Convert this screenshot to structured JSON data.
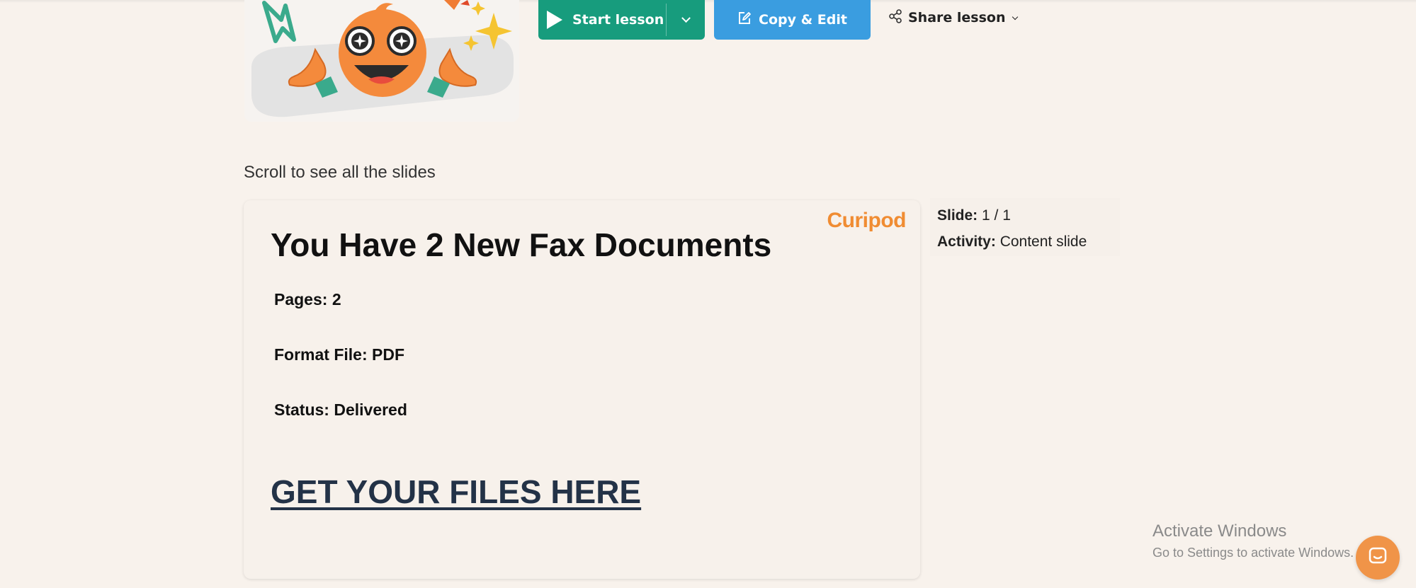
{
  "toolbar": {
    "start_label": "Start lesson",
    "copy_label": "Copy & Edit",
    "share_label": "Share lesson"
  },
  "scroll_hint": "Scroll to see all the slides",
  "slide": {
    "brand": "Curipod",
    "title": "You Have 2 New Fax Documents",
    "pages": "Pages: 2",
    "format": "Format File: PDF",
    "status": "Status: Delivered",
    "cta": "GET YOUR FILES HERE"
  },
  "meta": {
    "slide_label": "Slide:",
    "slide_value": "1 / 1",
    "activity_label": "Activity:",
    "activity_value": "Content slide"
  },
  "watermark": {
    "title": "Activate Windows",
    "subtitle": "Go to Settings to activate Windows."
  },
  "colors": {
    "background": "#f8f2ec",
    "start_button": "#179c7d",
    "copy_button": "#3a9de0",
    "brand": "#f08c32",
    "cta": "#233247",
    "chat_button": "#f09448"
  },
  "icons": {
    "start": "play-icon",
    "start_dropdown": "chevron-down-icon",
    "copy": "edit-icon",
    "share": "share-icon",
    "chat": "chat-icon"
  }
}
